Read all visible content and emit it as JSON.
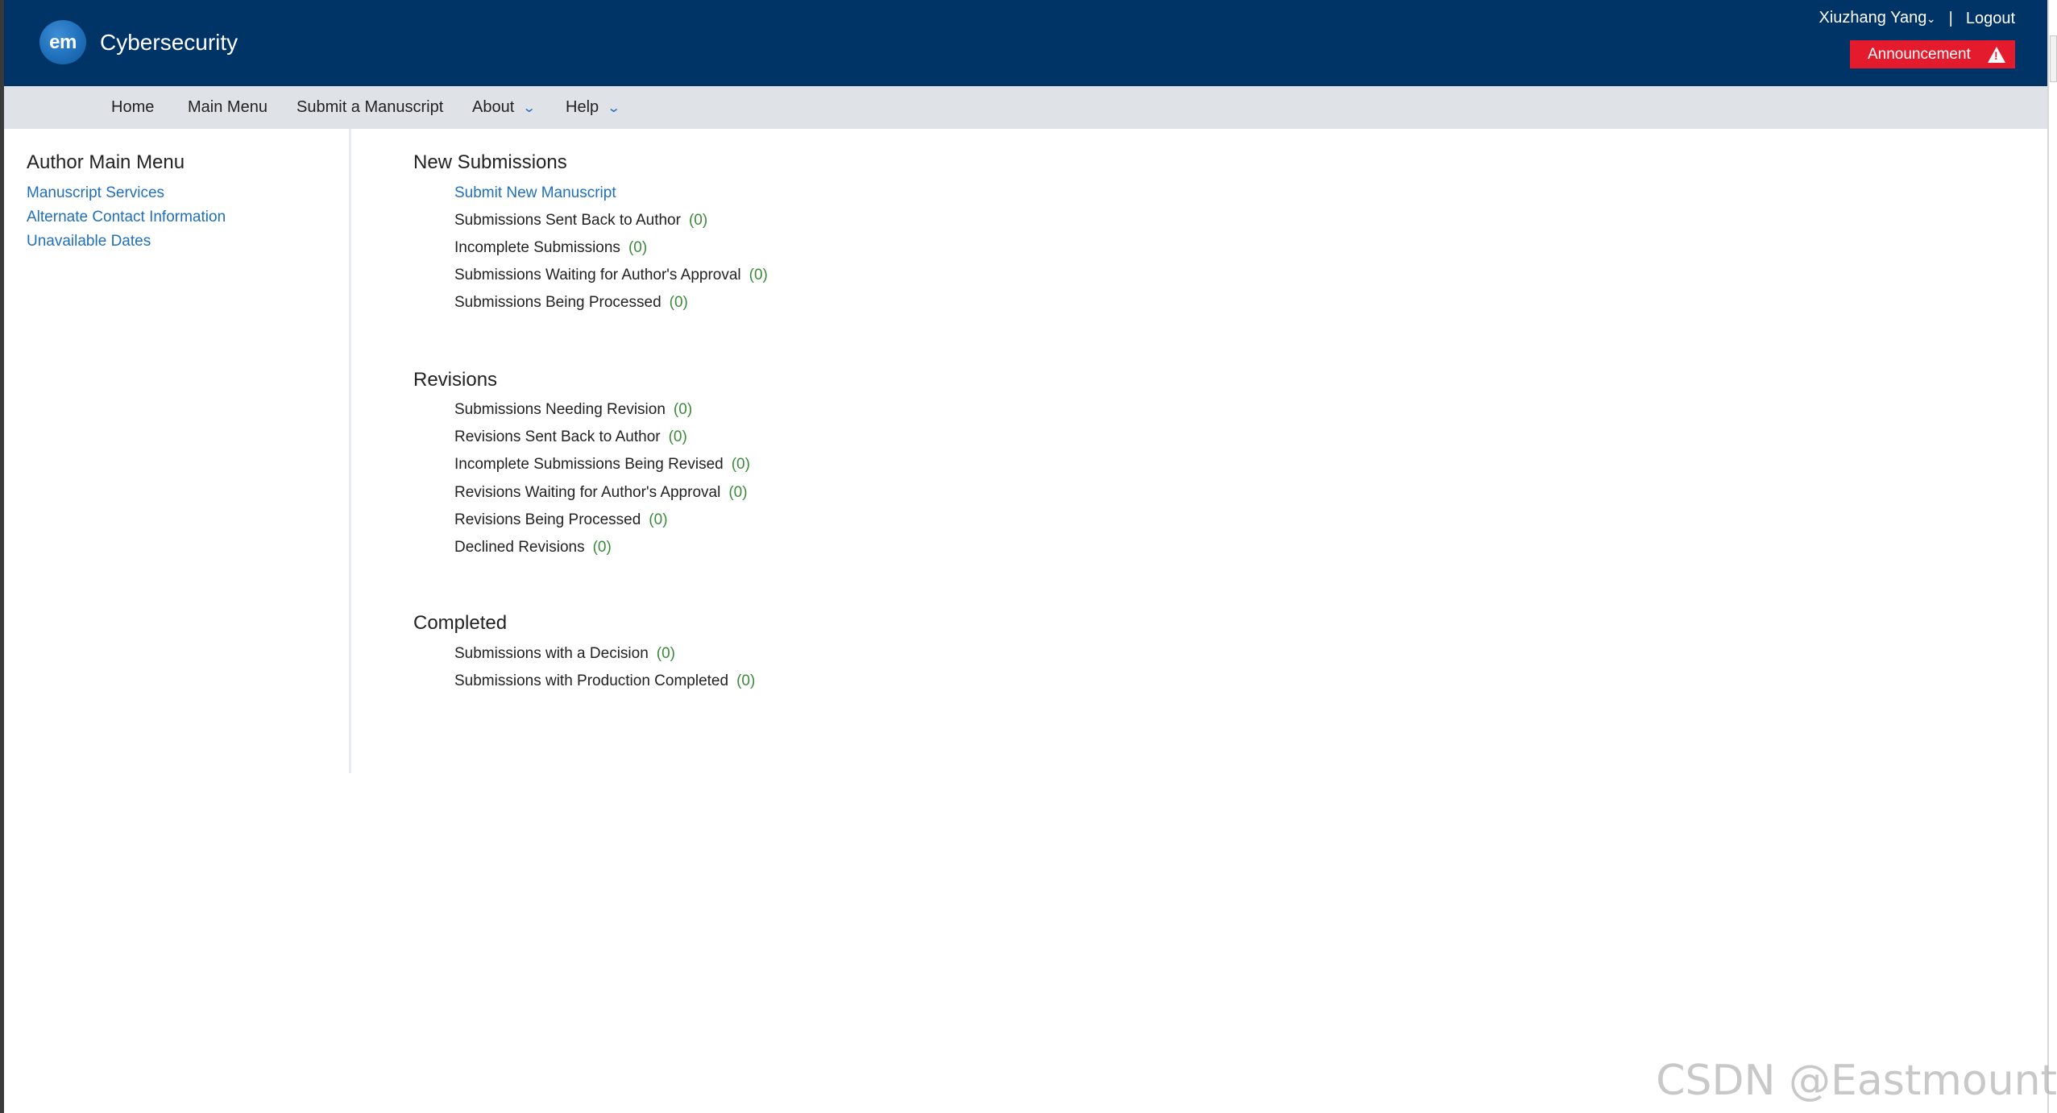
{
  "header": {
    "logo_text": "em",
    "site_title": "Cybersecurity",
    "user_name": "Xiuzhang Yang",
    "user_chevron": "⌄",
    "separator": "|",
    "logout_label": "Logout",
    "announcement_label": "Announcement"
  },
  "nav": {
    "home": "Home",
    "main_menu": "Main Menu",
    "submit": "Submit a Manuscript",
    "about": "About",
    "help": "Help"
  },
  "sidebar": {
    "title": "Author Main Menu",
    "links": [
      "Manuscript Services",
      "Alternate Contact Information",
      "Unavailable Dates"
    ]
  },
  "sections": {
    "new_submissions": {
      "title": "New Submissions",
      "submit_link": "Submit New Manuscript",
      "items": [
        {
          "label": "Submissions Sent Back to Author",
          "count": "(0)"
        },
        {
          "label": "Incomplete Submissions",
          "count": "(0)"
        },
        {
          "label": "Submissions Waiting for Author's Approval",
          "count": "(0)"
        },
        {
          "label": "Submissions Being Processed",
          "count": "(0)"
        }
      ]
    },
    "revisions": {
      "title": "Revisions",
      "items": [
        {
          "label": "Submissions Needing Revision",
          "count": "(0)"
        },
        {
          "label": "Revisions Sent Back to Author",
          "count": "(0)"
        },
        {
          "label": "Incomplete Submissions Being Revised",
          "count": "(0)"
        },
        {
          "label": "Revisions Waiting for Author's Approval",
          "count": "(0)"
        },
        {
          "label": "Revisions Being Processed",
          "count": "(0)"
        },
        {
          "label": "Declined Revisions",
          "count": "(0)"
        }
      ]
    },
    "completed": {
      "title": "Completed",
      "items": [
        {
          "label": "Submissions with a Decision",
          "count": "(0)"
        },
        {
          "label": "Submissions with Production Completed",
          "count": "(0)"
        }
      ]
    }
  },
  "watermark": "CSDN @Eastmount",
  "colors": {
    "header_bg": "#003366",
    "nav_bg": "#dfe3e8",
    "link": "#1f6fba",
    "count": "#3a8a3a",
    "announcement_bg": "#e31b2d"
  },
  "icons": {
    "logo": "em-logo-icon",
    "user_dropdown": "chevron-down-icon",
    "announcement": "warning-triangle-icon",
    "nav_dropdown": "chevron-down-icon"
  }
}
